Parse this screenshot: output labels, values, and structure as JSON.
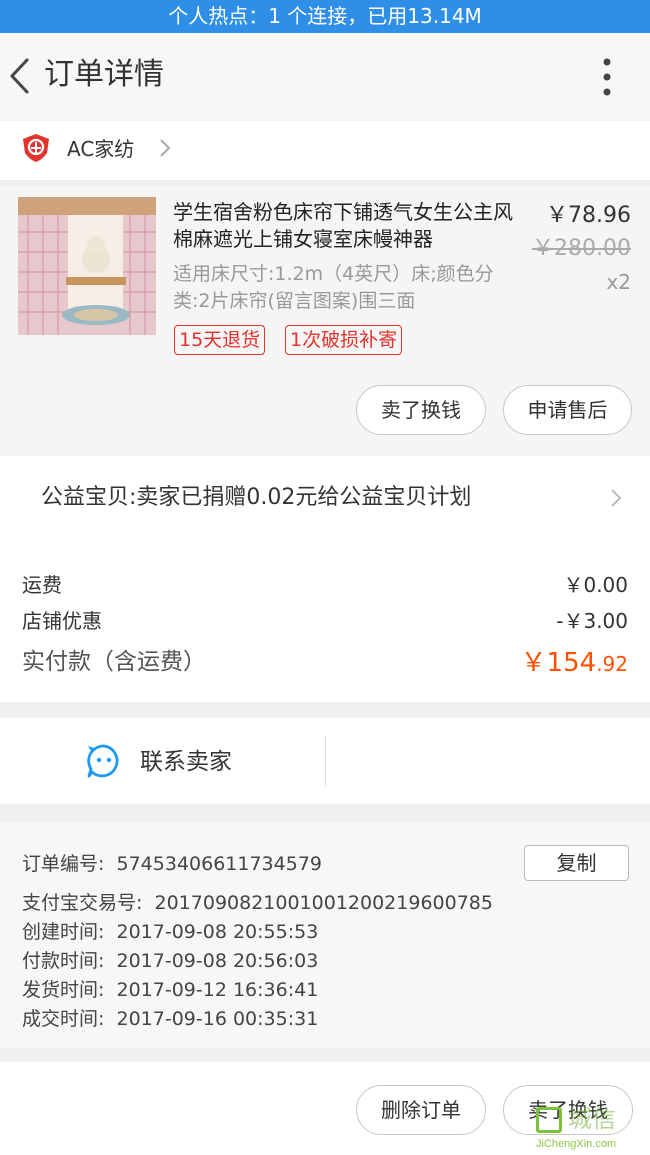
{
  "status_bar": {
    "hotspot_text": "个人热点：1 个连接，已用13.14M"
  },
  "app_bar": {
    "title": "订单详情"
  },
  "shop": {
    "name": "AC家纺"
  },
  "item": {
    "title": "学生宿舍粉色床帘下铺透气女生公主风棉麻遮光上铺女寝室床幔神器",
    "sku": "适用床尺寸:1.2m（4英尺）床;颜色分类:2片床帘(留言图案)围三面",
    "price": "￥78.96",
    "original_price": "￥280.00",
    "quantity": "x2",
    "tags": [
      "15天退货",
      "1次破损补寄"
    ],
    "actions": {
      "sell": "卖了换钱",
      "after_sale": "申请售后"
    }
  },
  "charity": {
    "text": "公益宝贝:卖家已捐赠0.02元给公益宝贝计划"
  },
  "summary": {
    "shipping_label": "运费",
    "shipping_value": "￥0.00",
    "discount_label": "店铺优惠",
    "discount_value": "-￥3.00",
    "paid_label": "实付款（含运费）",
    "paid_int": "￥154",
    "paid_dec": ".92"
  },
  "contact": {
    "label": "联系卖家"
  },
  "order_info": {
    "order_no_label": "订单编号:",
    "order_no": "57453406611734579",
    "copy_label": "复制",
    "alipay_label": "支付宝交易号:",
    "alipay_no": "2017090821001001200219600785",
    "created_label": "创建时间:",
    "created": "2017-09-08 20:55:53",
    "paid_time_label": "付款时间:",
    "paid_time": "2017-09-08 20:56:03",
    "shipped_label": "发货时间:",
    "shipped": "2017-09-12 16:36:41",
    "completed_label": "成交时间:",
    "completed": "2017-09-16 00:35:31"
  },
  "bottom_bar": {
    "delete_label": "删除订单",
    "sell_label": "卖了换钱"
  },
  "watermark": {
    "text": "城信",
    "url": "JiChengXin.com"
  },
  "colors": {
    "accent": "#ff5000",
    "status_bar": "#2f8fe6",
    "tag_red": "#e2332d"
  }
}
